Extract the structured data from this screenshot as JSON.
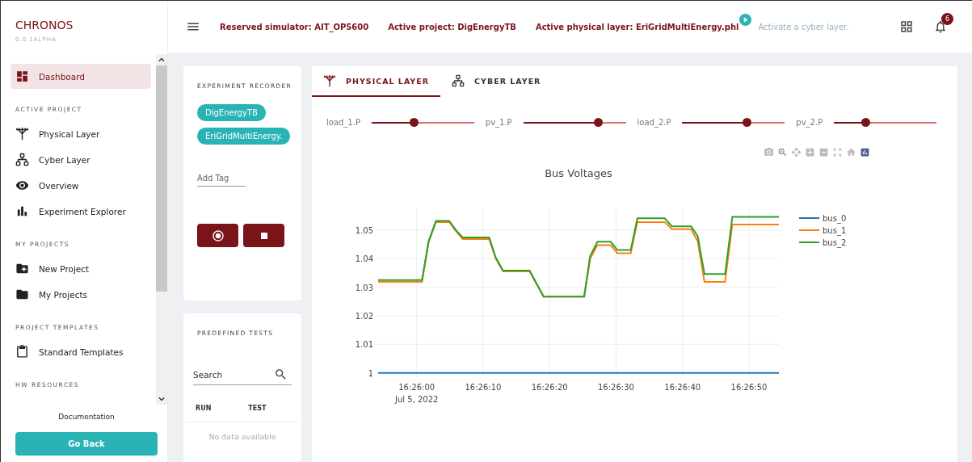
{
  "app": {
    "title": "CHRONOS",
    "version": "0.0.1ALPHA"
  },
  "sidebar": {
    "items": [
      {
        "kind": "item",
        "label": "Dashboard",
        "selected": true
      },
      {
        "kind": "heading",
        "label": "ACTIVE PROJECT"
      },
      {
        "kind": "item",
        "label": "Physical Layer",
        "selected": false
      },
      {
        "kind": "item",
        "label": "Cyber Layer",
        "selected": false
      },
      {
        "kind": "item",
        "label": "Overview",
        "selected": false
      },
      {
        "kind": "item",
        "label": "Experiment Explorer",
        "selected": false
      },
      {
        "kind": "heading",
        "label": "MY PROJECTS"
      },
      {
        "kind": "item",
        "label": "New Project",
        "selected": false
      },
      {
        "kind": "item",
        "label": "My Projects",
        "selected": false
      },
      {
        "kind": "heading",
        "label": "PROJECT TEMPLATES"
      },
      {
        "kind": "item",
        "label": "Standard Templates",
        "selected": false
      },
      {
        "kind": "heading",
        "label": "HW RESOURCES"
      }
    ],
    "documentation": "Documentation",
    "go_back": "Go Back"
  },
  "topbar": {
    "items": [
      {
        "text": "Reserved simulator: AIT_OP5600",
        "active": true,
        "play": false
      },
      {
        "text": "Active project: DigEnergyTB",
        "active": true,
        "play": false
      },
      {
        "text": "Active physical layer: EriGridMultiEnergy.phl",
        "active": true,
        "play": true
      },
      {
        "text": "Activate a cyber layer.",
        "active": false,
        "play": false
      }
    ],
    "notifications": "6"
  },
  "recorder": {
    "title": "EXPERIMENT RECORDER",
    "tags": [
      "DigEnergyTB",
      "EriGridMultiEnergy."
    ],
    "tag_placeholder": "Add Tag"
  },
  "tests": {
    "title": "PREDEFINED TESTS",
    "search_placeholder": "Search",
    "columns": [
      "RUN",
      "TEST"
    ],
    "empty": "No data available"
  },
  "tabs": [
    {
      "label": "PHYSICAL LAYER",
      "selected": true
    },
    {
      "label": "CYBER LAYER",
      "selected": false
    }
  ],
  "sliders": [
    {
      "label": "load_1.P",
      "level": 0.41
    },
    {
      "label": "pv_1.P",
      "level": 0.73
    },
    {
      "label": "load_2.P",
      "level": 0.63
    },
    {
      "label": "pv_2.P",
      "level": 0.31
    }
  ],
  "chart": {
    "chart_data": {
      "type": "line",
      "title": "Bus Voltages",
      "grid": true,
      "legend": true,
      "x": [
        59154.2,
        59160.8,
        59161.8,
        59162.9,
        59164.9,
        59165.9,
        59166.9,
        59170.9,
        59171.9,
        59173.0,
        59177.0,
        59179.1,
        59185.2,
        59186.1,
        59187.2,
        59189.2,
        59190.2,
        59192.2,
        59193.2,
        59197.3,
        59198.4,
        59201.3,
        59202.3,
        59203.3,
        59206.4,
        59207.5,
        59214.5
      ],
      "series": [
        {
          "name": "bus_0",
          "color": "#1f77b4",
          "values": [
            1,
            1,
            1,
            1,
            1,
            1,
            1,
            1,
            1,
            1,
            1,
            1,
            1,
            1,
            1,
            1,
            1,
            1,
            1,
            1,
            1,
            1,
            1,
            1,
            1,
            1,
            1
          ]
        },
        {
          "name": "bus_1",
          "color": "#ff7f0e",
          "values": [
            1.0319,
            1.0319,
            1.0458,
            1.0528,
            1.0528,
            1.0497,
            1.0468,
            1.0468,
            1.04,
            1.0355,
            1.0355,
            1.0267,
            1.0267,
            1.04,
            1.0447,
            1.0447,
            1.0419,
            1.0419,
            1.0528,
            1.0528,
            1.0503,
            1.0503,
            1.046,
            1.0319,
            1.0319,
            1.0519,
            1.0519
          ]
        },
        {
          "name": "bus_2",
          "color": "#2ca02c",
          "values": [
            1.0325,
            1.0325,
            1.0461,
            1.0532,
            1.0532,
            1.05,
            1.0474,
            1.0474,
            1.0403,
            1.0358,
            1.0358,
            1.0267,
            1.0267,
            1.0409,
            1.0459,
            1.0459,
            1.043,
            1.043,
            1.0541,
            1.0541,
            1.0513,
            1.0513,
            1.0478,
            1.0346,
            1.0346,
            1.0546,
            1.0546
          ]
        }
      ],
      "xlim": [
        59154.2,
        59214.5
      ],
      "ylim": [
        0.9985,
        1.0573
      ],
      "xticks": [
        {
          "value": 59160,
          "label": "16:26:00\nJul 5, 2022"
        },
        {
          "value": 59170,
          "label": "16:26:10"
        },
        {
          "value": 59180,
          "label": "16:26:20"
        },
        {
          "value": 59190,
          "label": "16:26:30"
        },
        {
          "value": 59200,
          "label": "16:26:40"
        },
        {
          "value": 59210,
          "label": "16:26:50"
        }
      ],
      "yticks": [
        {
          "value": 1,
          "label": "1"
        },
        {
          "value": 1.01,
          "label": "1.01"
        },
        {
          "value": 1.02,
          "label": "1.02"
        },
        {
          "value": 1.03,
          "label": "1.03"
        },
        {
          "value": 1.04,
          "label": "1.04"
        },
        {
          "value": 1.05,
          "label": "1.05"
        }
      ]
    }
  }
}
